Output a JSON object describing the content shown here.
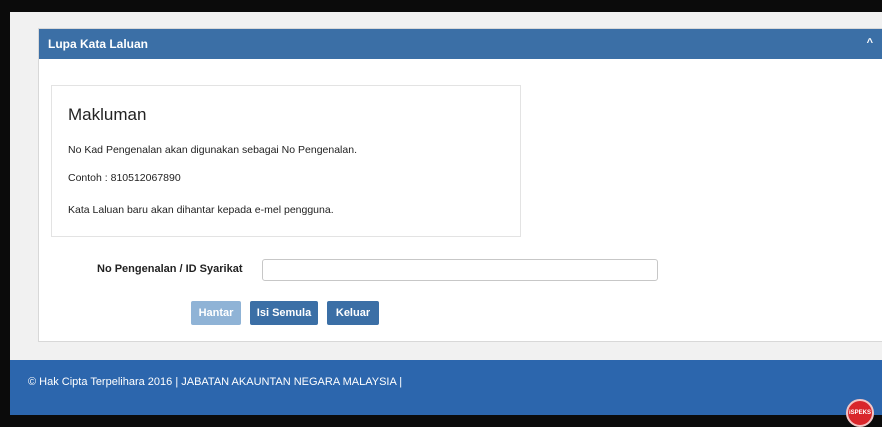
{
  "panel": {
    "title": "Lupa Kata Laluan",
    "collapse_icon": "chevron-up-icon",
    "collapse_glyph": "^"
  },
  "info": {
    "title": "Makluman",
    "lines": [
      "No Kad Pengenalan akan digunakan sebagai No Pengenalan.",
      "Contoh : 810512067890",
      "Kata Laluan baru akan dihantar kepada e-mel pengguna."
    ]
  },
  "form": {
    "label": "No Pengenalan / ID Syarikat",
    "value": "",
    "placeholder": ""
  },
  "buttons": {
    "submit": "Hantar",
    "reset": "Isi Semula",
    "exit": "Keluar"
  },
  "footer": {
    "text": "© Hak Cipta Terpelihara 2016 | JABATAN AKAUNTAN NEGARA MALAYSIA |",
    "logo_text": "iSPEKS"
  },
  "colors": {
    "header": "#3b6fa6",
    "footer": "#2c66ad",
    "button_disabled": "#8fb3d6",
    "logo": "#d9262b"
  }
}
